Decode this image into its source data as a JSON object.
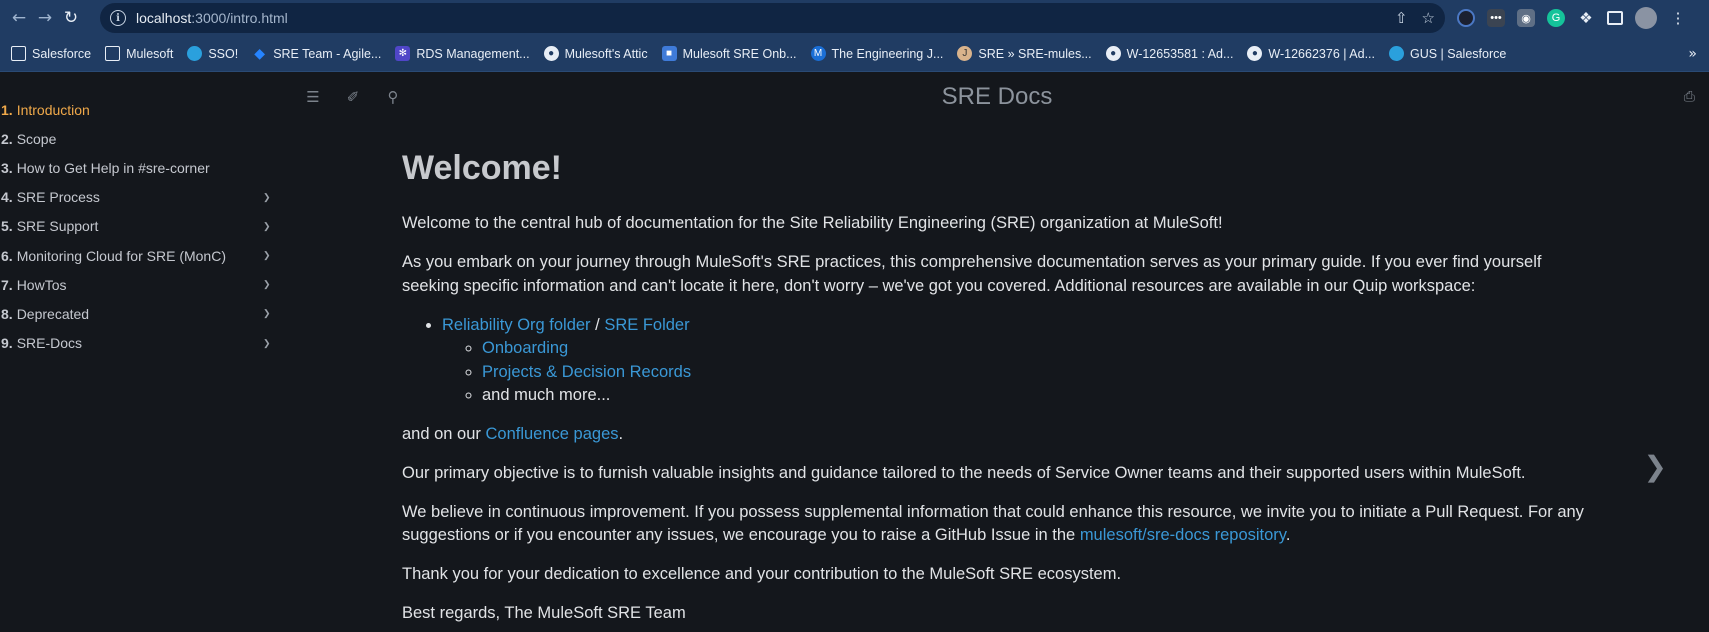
{
  "browser": {
    "url_host": "localhost",
    "url_path": ":3000/intro.html",
    "bookmarks": [
      {
        "label": "Salesforce",
        "icon": "folder-icon"
      },
      {
        "label": "Mulesoft",
        "icon": "folder-icon"
      },
      {
        "label": "SSO!",
        "icon": "cloud-icon"
      },
      {
        "label": "SRE Team - Agile...",
        "icon": "jira-icon"
      },
      {
        "label": "RDS Management...",
        "icon": "rds-icon"
      },
      {
        "label": "Mulesoft's Attic",
        "icon": "github-icon"
      },
      {
        "label": "Mulesoft SRE Onb...",
        "icon": "doc-icon"
      },
      {
        "label": "The Engineering J...",
        "icon": "mulesoft-icon"
      },
      {
        "label": "SRE » SRE-mules...",
        "icon": "jenkins-icon"
      },
      {
        "label": "W-12653581 : Ad...",
        "icon": "github-icon"
      },
      {
        "label": "W-12662376 | Ad...",
        "icon": "github-icon"
      },
      {
        "label": "GUS | Salesforce",
        "icon": "cloud-icon"
      }
    ],
    "bookmarks_more": "»"
  },
  "sidebar": {
    "items": [
      {
        "num": "1.",
        "label": "Introduction",
        "has_children": false
      },
      {
        "num": "2.",
        "label": "Scope",
        "has_children": false
      },
      {
        "num": "3.",
        "label": "How to Get Help in #sre-corner",
        "has_children": false
      },
      {
        "num": "4.",
        "label": "SRE Process",
        "has_children": true
      },
      {
        "num": "5.",
        "label": "SRE Support",
        "has_children": true
      },
      {
        "num": "6.",
        "label": "Monitoring Cloud for SRE (MonC)",
        "has_children": true
      },
      {
        "num": "7.",
        "label": "HowTos",
        "has_children": true
      },
      {
        "num": "8.",
        "label": "Deprecated",
        "has_children": true
      },
      {
        "num": "9.",
        "label": "SRE-Docs",
        "has_children": true
      }
    ]
  },
  "menu": {
    "title": "SRE Docs"
  },
  "content": {
    "heading": "Welcome!",
    "p1": "Welcome to the central hub of documentation for the Site Reliability Engineering (SRE) organization at MuleSoft!",
    "p2": "As you embark on your journey through MuleSoft's SRE practices, this comprehensive documentation serves as your primary guide. If you ever find yourself seeking specific information and can't locate it here, don't worry – we've got you covered. Additional resources are available in our Quip workspace:",
    "link_reliability": "Reliability Org folder",
    "sep": " / ",
    "link_sre_folder": "SRE Folder",
    "link_onboarding": "Onboarding",
    "link_projects": "Projects & Decision Records",
    "more": "and much more...",
    "p3_pre": "and on our ",
    "link_confluence": "Confluence pages",
    "p3_post": ".",
    "p4": "Our primary objective is to furnish valuable insights and guidance tailored to the needs of Service Owner teams and their supported users within MuleSoft.",
    "p5_pre": "We believe in continuous improvement. If you possess supplemental information that could enhance this resource, we invite you to initiate a Pull Request. For any suggestions or if you encounter any issues, we encourage you to raise a GitHub Issue in the ",
    "link_repo": "mulesoft/sre-docs repository",
    "p5_post": ".",
    "p6": "Thank you for your dedication to excellence and your contribution to the MuleSoft SRE ecosystem.",
    "p7": "Best regards, The MuleSoft SRE Team"
  },
  "colors": {
    "accent_active": "#f0a94a",
    "link": "#3a98d6",
    "background": "#14171c",
    "chrome": "#203c63"
  }
}
